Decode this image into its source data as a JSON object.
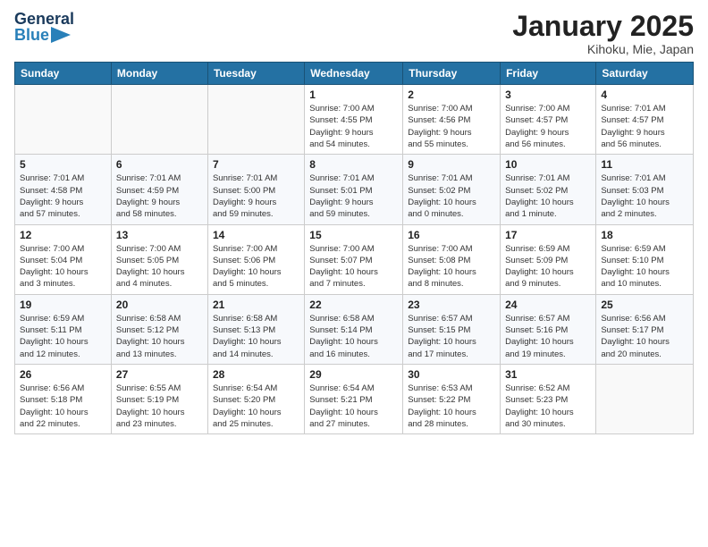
{
  "header": {
    "logo_general": "General",
    "logo_blue": "Blue",
    "title": "January 2025",
    "subtitle": "Kihoku, Mie, Japan"
  },
  "weekdays": [
    "Sunday",
    "Monday",
    "Tuesday",
    "Wednesday",
    "Thursday",
    "Friday",
    "Saturday"
  ],
  "weeks": [
    [
      {
        "day": "",
        "info": ""
      },
      {
        "day": "",
        "info": ""
      },
      {
        "day": "",
        "info": ""
      },
      {
        "day": "1",
        "info": "Sunrise: 7:00 AM\nSunset: 4:55 PM\nDaylight: 9 hours\nand 54 minutes."
      },
      {
        "day": "2",
        "info": "Sunrise: 7:00 AM\nSunset: 4:56 PM\nDaylight: 9 hours\nand 55 minutes."
      },
      {
        "day": "3",
        "info": "Sunrise: 7:00 AM\nSunset: 4:57 PM\nDaylight: 9 hours\nand 56 minutes."
      },
      {
        "day": "4",
        "info": "Sunrise: 7:01 AM\nSunset: 4:57 PM\nDaylight: 9 hours\nand 56 minutes."
      }
    ],
    [
      {
        "day": "5",
        "info": "Sunrise: 7:01 AM\nSunset: 4:58 PM\nDaylight: 9 hours\nand 57 minutes."
      },
      {
        "day": "6",
        "info": "Sunrise: 7:01 AM\nSunset: 4:59 PM\nDaylight: 9 hours\nand 58 minutes."
      },
      {
        "day": "7",
        "info": "Sunrise: 7:01 AM\nSunset: 5:00 PM\nDaylight: 9 hours\nand 59 minutes."
      },
      {
        "day": "8",
        "info": "Sunrise: 7:01 AM\nSunset: 5:01 PM\nDaylight: 9 hours\nand 59 minutes."
      },
      {
        "day": "9",
        "info": "Sunrise: 7:01 AM\nSunset: 5:02 PM\nDaylight: 10 hours\nand 0 minutes."
      },
      {
        "day": "10",
        "info": "Sunrise: 7:01 AM\nSunset: 5:02 PM\nDaylight: 10 hours\nand 1 minute."
      },
      {
        "day": "11",
        "info": "Sunrise: 7:01 AM\nSunset: 5:03 PM\nDaylight: 10 hours\nand 2 minutes."
      }
    ],
    [
      {
        "day": "12",
        "info": "Sunrise: 7:00 AM\nSunset: 5:04 PM\nDaylight: 10 hours\nand 3 minutes."
      },
      {
        "day": "13",
        "info": "Sunrise: 7:00 AM\nSunset: 5:05 PM\nDaylight: 10 hours\nand 4 minutes."
      },
      {
        "day": "14",
        "info": "Sunrise: 7:00 AM\nSunset: 5:06 PM\nDaylight: 10 hours\nand 5 minutes."
      },
      {
        "day": "15",
        "info": "Sunrise: 7:00 AM\nSunset: 5:07 PM\nDaylight: 10 hours\nand 7 minutes."
      },
      {
        "day": "16",
        "info": "Sunrise: 7:00 AM\nSunset: 5:08 PM\nDaylight: 10 hours\nand 8 minutes."
      },
      {
        "day": "17",
        "info": "Sunrise: 6:59 AM\nSunset: 5:09 PM\nDaylight: 10 hours\nand 9 minutes."
      },
      {
        "day": "18",
        "info": "Sunrise: 6:59 AM\nSunset: 5:10 PM\nDaylight: 10 hours\nand 10 minutes."
      }
    ],
    [
      {
        "day": "19",
        "info": "Sunrise: 6:59 AM\nSunset: 5:11 PM\nDaylight: 10 hours\nand 12 minutes."
      },
      {
        "day": "20",
        "info": "Sunrise: 6:58 AM\nSunset: 5:12 PM\nDaylight: 10 hours\nand 13 minutes."
      },
      {
        "day": "21",
        "info": "Sunrise: 6:58 AM\nSunset: 5:13 PM\nDaylight: 10 hours\nand 14 minutes."
      },
      {
        "day": "22",
        "info": "Sunrise: 6:58 AM\nSunset: 5:14 PM\nDaylight: 10 hours\nand 16 minutes."
      },
      {
        "day": "23",
        "info": "Sunrise: 6:57 AM\nSunset: 5:15 PM\nDaylight: 10 hours\nand 17 minutes."
      },
      {
        "day": "24",
        "info": "Sunrise: 6:57 AM\nSunset: 5:16 PM\nDaylight: 10 hours\nand 19 minutes."
      },
      {
        "day": "25",
        "info": "Sunrise: 6:56 AM\nSunset: 5:17 PM\nDaylight: 10 hours\nand 20 minutes."
      }
    ],
    [
      {
        "day": "26",
        "info": "Sunrise: 6:56 AM\nSunset: 5:18 PM\nDaylight: 10 hours\nand 22 minutes."
      },
      {
        "day": "27",
        "info": "Sunrise: 6:55 AM\nSunset: 5:19 PM\nDaylight: 10 hours\nand 23 minutes."
      },
      {
        "day": "28",
        "info": "Sunrise: 6:54 AM\nSunset: 5:20 PM\nDaylight: 10 hours\nand 25 minutes."
      },
      {
        "day": "29",
        "info": "Sunrise: 6:54 AM\nSunset: 5:21 PM\nDaylight: 10 hours\nand 27 minutes."
      },
      {
        "day": "30",
        "info": "Sunrise: 6:53 AM\nSunset: 5:22 PM\nDaylight: 10 hours\nand 28 minutes."
      },
      {
        "day": "31",
        "info": "Sunrise: 6:52 AM\nSunset: 5:23 PM\nDaylight: 10 hours\nand 30 minutes."
      },
      {
        "day": "",
        "info": ""
      }
    ]
  ]
}
